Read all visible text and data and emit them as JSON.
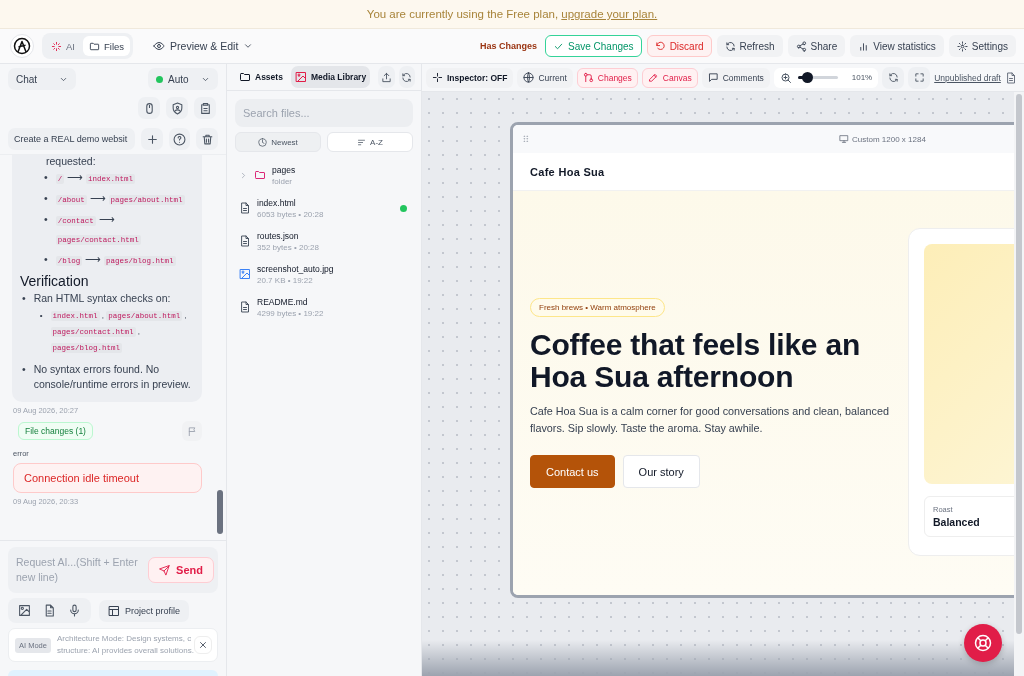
{
  "banner": {
    "text": "You are currently using the Free plan, ",
    "link": "upgrade your plan."
  },
  "header": {
    "mode_tabs": [
      {
        "label": "AI",
        "kind": "ai",
        "selected": false
      },
      {
        "label": "Files",
        "kind": "files",
        "selected": true
      }
    ],
    "view_menu": "Preview & Edit",
    "status": "Has Changes",
    "actions": [
      {
        "label": "Save Changes",
        "kind": "save"
      },
      {
        "label": "Discard",
        "kind": "discard"
      },
      {
        "label": "Refresh",
        "kind": "refresh"
      },
      {
        "label": "Share",
        "kind": "share"
      },
      {
        "label": "View statistics",
        "kind": "stats"
      },
      {
        "label": "Settings",
        "kind": "settings"
      }
    ]
  },
  "chat": {
    "mode_select": "Chat",
    "model_select": "Auto",
    "conversation_select": "Create a REAL demo websit",
    "message": {
      "intro": "requested:",
      "bullet": "•",
      "routes": [
        {
          "path": "/",
          "arrow": "⟶",
          "target": "index.html"
        },
        {
          "path": "/about",
          "arrow": "⟶",
          "target": "pages/about.html"
        },
        {
          "path": "/contact",
          "arrow": "⟶",
          "target": "pages/contact.html"
        },
        {
          "path": "/blog",
          "arrow": "⟶",
          "target": "pages/blog.html"
        }
      ],
      "heading": "Verification",
      "bullets": [
        {
          "text": "Ran HTML syntax checks on:",
          "files": [
            "index.html",
            "pages/about.html",
            "pages/contact.html",
            "pages/blog.html"
          ],
          "separator": ","
        },
        {
          "text": "No syntax errors found. No console/runtime errors in preview."
        }
      ],
      "time": "09 Aug 2026, 20:27",
      "file_changes": "File changes (1)"
    },
    "error": {
      "label": "error",
      "text": "Connection idle timeout",
      "time": "09 Aug 2026, 20:33"
    },
    "input": {
      "placeholder": "Request AI...(Shift + Enter new line)",
      "send": "Send"
    },
    "project_profile": "Project profile",
    "notice": {
      "tag": "AI Mode",
      "lines": [
        "Architecture Mode: Design systems, c",
        "structure: AI provides overall solutions."
      ]
    }
  },
  "files": {
    "tabs": [
      {
        "label": "Assets",
        "kind": "folder",
        "selected": false
      },
      {
        "label": "Media Library",
        "kind": "media",
        "selected": true
      }
    ],
    "search_placeholder": "Search files...",
    "sort": [
      {
        "label": "Newest",
        "kind": "time",
        "selected": false
      },
      {
        "label": "A-Z",
        "kind": "name",
        "selected": true
      }
    ],
    "items": [
      {
        "kind": "folder",
        "name": "pages",
        "meta": "folder",
        "expanded": false
      },
      {
        "kind": "file",
        "name": "index.html",
        "meta": "6053 bytes • 20:28",
        "modified": true
      },
      {
        "kind": "file",
        "name": "routes.json",
        "meta": "352 bytes • 20:28",
        "modified": false
      },
      {
        "kind": "image",
        "name": "screenshot_auto.jpg",
        "meta": "20.7 KB • 19:22",
        "modified": false
      },
      {
        "kind": "file",
        "name": "README.md",
        "meta": "4299 bytes • 19:22",
        "modified": false
      }
    ]
  },
  "canvas": {
    "tools": [
      {
        "kind": "inspector",
        "label": "Inspector: OFF",
        "active": false
      },
      {
        "kind": "current",
        "label": "Current",
        "active": false
      },
      {
        "kind": "changes",
        "label": "Changes",
        "active": true
      },
      {
        "kind": "canvas",
        "label": "Canvas",
        "active": true
      },
      {
        "kind": "comments",
        "label": "Comments",
        "active": false
      }
    ],
    "zoom": {
      "level": 0.22,
      "reading": "101%"
    },
    "draft_link": "Unpublished draft",
    "preview": {
      "device": "Custom 1200 x 1284",
      "brand": "Cafe Hoa Sua",
      "badge": "Fresh brews • Warm atmosphere",
      "headline": "Coffee that feels like an Hoa Sua afternoon",
      "body": "Cafe Hoa Sua is a calm corner for good conversations and clean, balanced flavors. Sip slowly. Taste the aroma. Stay awhile.",
      "buttons": [
        {
          "label": "Contact us",
          "kind": "primary"
        },
        {
          "label": "Our story",
          "kind": "secondary"
        }
      ],
      "card": {
        "label": "Roast",
        "value": "Balanced"
      }
    }
  }
}
